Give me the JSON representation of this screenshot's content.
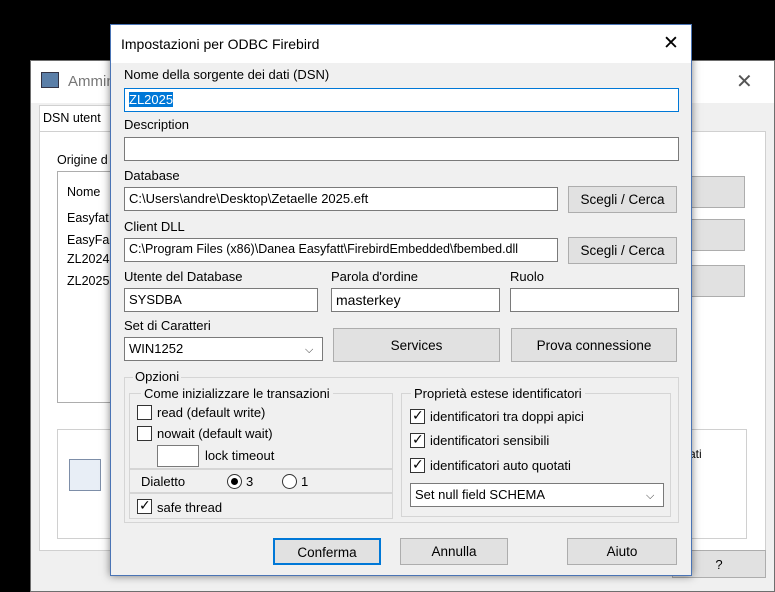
{
  "background_window": {
    "title": "Ammini",
    "tab": "DSN utent",
    "group_label": "Origine d",
    "list_header": "Nome",
    "list_items": [
      "Easyfat",
      "EasyFa",
      "ZL2024",
      "ZL2025"
    ],
    "side_text": "ati",
    "help_button": "?"
  },
  "dialog": {
    "title": "Impostazioni per ODBC Firebird",
    "dsn_label": "Nome della sorgente dei dati (DSN)",
    "dsn_value": "ZL2025",
    "description_label": "Description",
    "description_value": "",
    "database_label": "Database",
    "database_value": "C:\\Users\\andre\\Desktop\\Zetaelle 2025.eft",
    "browse_label": "Scegli / Cerca",
    "client_dll_label": "Client DLL",
    "client_dll_value": "C:\\Program Files (x86)\\Danea Easyfatt\\FirebirdEmbedded\\fbembed.dll",
    "user_label": "Utente del Database",
    "user_value": "SYSDBA",
    "password_label": "Parola d'ordine",
    "password_value": "masterkey",
    "role_label": "Ruolo",
    "role_value": "",
    "charset_label": "Set di Caratteri",
    "charset_value": "WIN1252",
    "services_button": "Services",
    "test_button": "Prova connessione",
    "options": {
      "group_label": "Opzioni",
      "transactions_label": "Come inizializzare le transazioni",
      "read_label": "read (default write)",
      "read_checked": false,
      "nowait_label": "nowait (default wait)",
      "nowait_checked": false,
      "lock_timeout_label": "lock timeout",
      "lock_timeout_value": "",
      "dialect_label": "Dialetto",
      "dialect_3": "3",
      "dialect_1": "1",
      "dialect_selected": "3",
      "safe_thread_label": "safe thread",
      "safe_thread_checked": true,
      "identifiers_label": "Proprietà estese identificatori",
      "quoted_label": "identificatori tra doppi apici",
      "quoted_checked": true,
      "sensitive_label": "identificatori sensibili",
      "sensitive_checked": true,
      "autoquoted_label": "identificatori auto quotati",
      "autoquoted_checked": true,
      "null_field_value": "Set null field SCHEMA"
    },
    "confirm_button": "Conferma",
    "cancel_button": "Annulla",
    "help_button": "Aiuto"
  },
  "colors": {
    "selection": "#0078d7",
    "dialog_bg": "#f0f0f0",
    "button_bg": "#e1e1e1",
    "focus_border": "#0078d7"
  }
}
